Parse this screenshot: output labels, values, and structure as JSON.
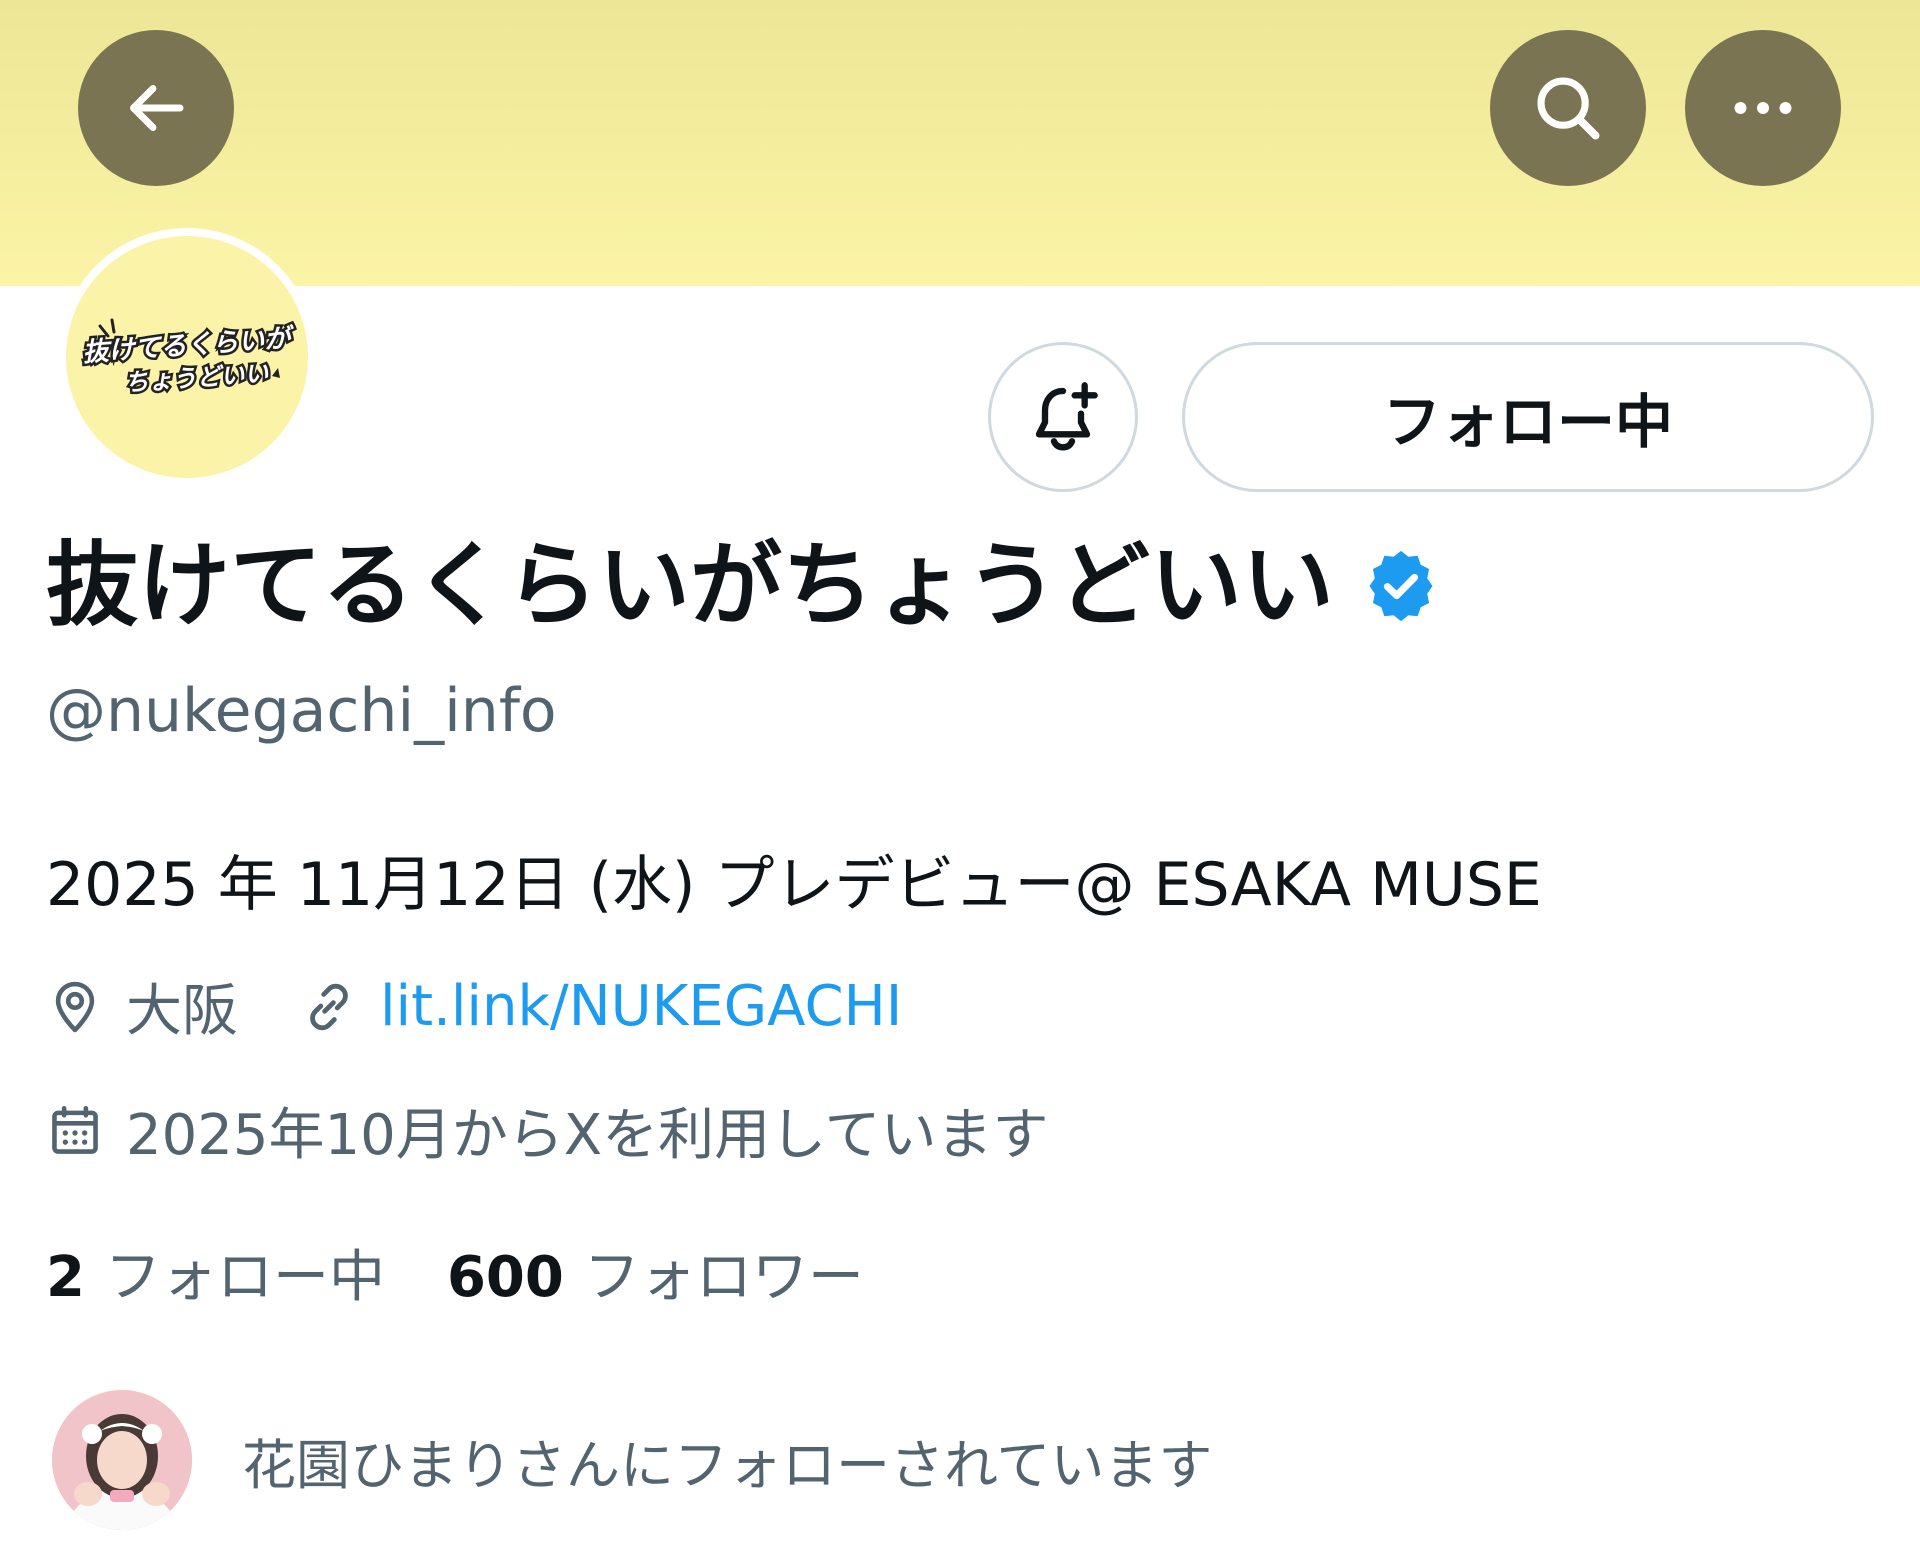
{
  "colors": {
    "banner": "#f6ef9f",
    "header_button_bg": "#7a7452",
    "text_primary": "#0f1419",
    "text_secondary": "#536471",
    "link": "#1d9bf0",
    "verified": "#1d9bf0",
    "button_border": "#cfd9de"
  },
  "header": {
    "back_icon": "arrow-left-icon",
    "search_icon": "search-icon",
    "more_icon": "more-horizontal-icon"
  },
  "profile": {
    "avatar_logo_line1": "抜けてるくらいが",
    "avatar_logo_line2": "ちょうどいい",
    "notify_icon": "bell-plus-icon",
    "follow_button_label": "フォロー中",
    "display_name": "抜けてるくらいがちょうどいい",
    "verified_icon": "verified-badge-icon",
    "handle": "@nukegachi_info",
    "bio": "2025 年 11月12日 (水) プレデビュー@ ESAKA MUSE",
    "location_icon": "location-pin-icon",
    "location": "大阪",
    "link_icon": "link-icon",
    "link": "lit.link/NUKEGACHI",
    "calendar_icon": "calendar-icon",
    "joined": "2025年10月からXを利用しています"
  },
  "stats": {
    "following_count": "2",
    "following_label": "フォロー中",
    "followers_count": "600",
    "followers_label": "フォロワー"
  },
  "followed_by": {
    "text": "花園ひまりさんにフォローされています"
  }
}
